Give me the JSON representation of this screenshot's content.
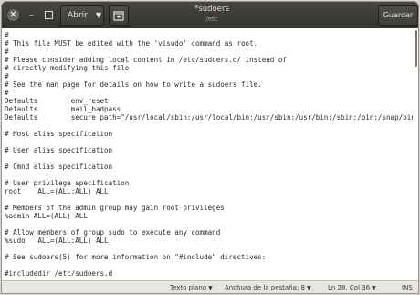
{
  "window": {
    "title": "*sudoers",
    "subtitle": "/etc"
  },
  "toolbar": {
    "open_label": "Abrir",
    "save_label": "Guardar"
  },
  "editor": {
    "lines": [
      "#",
      "# This file MUST be edited with the 'visudo' command as root.",
      "#",
      "# Please consider adding local content in /etc/sudoers.d/ instead of",
      "# directly modifying this file.",
      "#",
      "# See the man page for details on how to write a sudoers file.",
      "#",
      "Defaults        env_reset",
      "Defaults        mail_badpass",
      "Defaults        secure_path=\"/usr/local/sbin:/usr/local/bin:/usr/sbin:/usr/bin:/sbin:/bin:/snap/bin\"",
      "",
      "# Host alias specification",
      "",
      "# User alias specification",
      "",
      "# Cmnd alias specification",
      "",
      "# User privilege specification",
      "root    ALL=(ALL:ALL) ALL",
      "",
      "# Members of the admin group may gain root privileges",
      "%admin ALL=(ALL) ALL",
      "",
      "# Allow members of group sudo to execute any command",
      "%sudo   ALL=(ALL:ALL) ALL",
      "",
      "# See sudoers(5) for more information on \"#include\" directives:",
      "",
      "#includedir /etc/sudoers.d"
    ]
  },
  "statusbar": {
    "language": "Texto plano",
    "tab_width": "Anchura de la pestaña: 8",
    "position": "Ln 28, Col 36",
    "mode": "INS"
  }
}
